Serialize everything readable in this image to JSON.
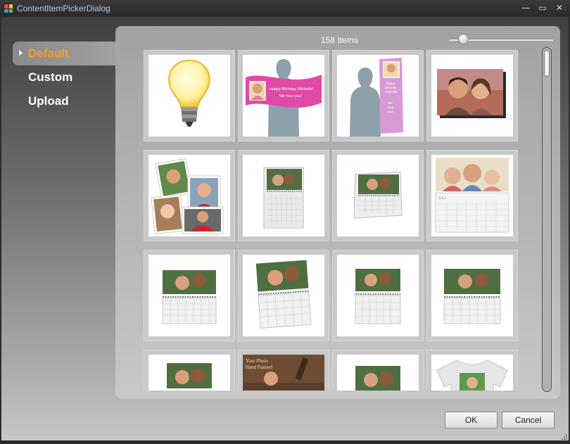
{
  "window": {
    "title": "ContentItemPickerDialog"
  },
  "controls": {
    "minimize": "—",
    "maximize": "▭",
    "close": "✕"
  },
  "nav": {
    "items": [
      {
        "label": "Default",
        "active": true
      },
      {
        "label": "Custom",
        "active": false
      },
      {
        "label": "Upload",
        "active": false
      }
    ]
  },
  "gallery": {
    "count_label": "158 Items",
    "zoom_level": 0.1,
    "banner_text": "Happy Birthday, Michelle!\nWe love you!",
    "vertical_banner_text": "Happy\nBirthday\nMichelle!\n\nWe\nlove\nyou!",
    "calendar_month": "JULY",
    "hand_painted_title": "Your Photo\nHand Painted"
  },
  "buttons": {
    "ok": "OK",
    "cancel": "Cancel"
  },
  "colors": {
    "accent": "#ff9a1c",
    "banner_pink": "#e04aa6",
    "silhouette": "#8fa0ad"
  }
}
